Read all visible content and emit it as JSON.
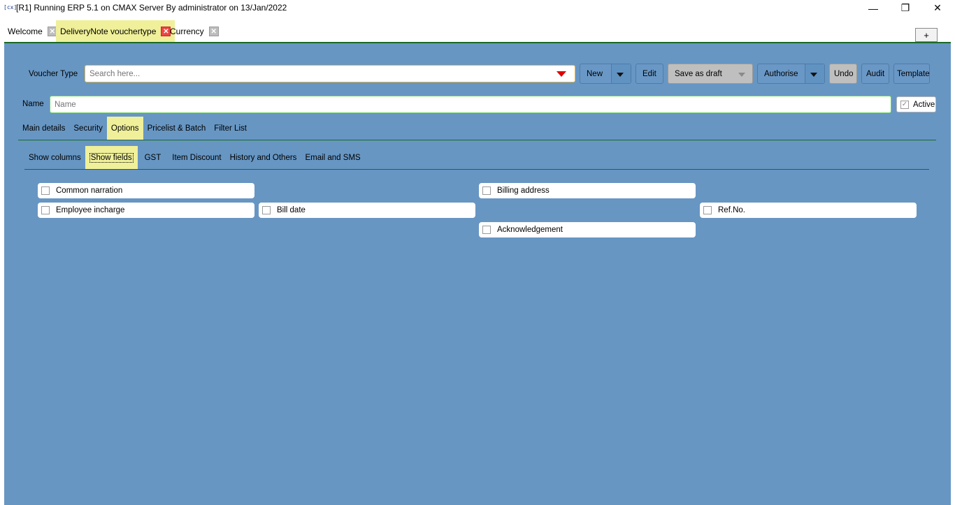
{
  "window": {
    "app_icon": "[cx]",
    "title": "[R1] Running ERP 5.1 on CMAX Server By administrator on 13/Jan/2022",
    "minimize": "—",
    "maximize": "❐",
    "close": "✕"
  },
  "doc_tabs": [
    {
      "label": "Welcome",
      "close": "✕"
    },
    {
      "label": "DeliveryNote vouchertype",
      "close": "✕"
    },
    {
      "label": "Currency",
      "close": "✕"
    }
  ],
  "new_tab_button": "+",
  "voucher_type": {
    "label": "Voucher Type",
    "search_placeholder": "Search here..."
  },
  "toolbar": {
    "new": "New",
    "edit": "Edit",
    "save_as_draft": "Save as draft",
    "authorise": "Authorise",
    "undo": "Undo",
    "audit": "Audit",
    "template": "Template"
  },
  "name_row": {
    "label": "Name",
    "placeholder": "Name",
    "active_label": "Active",
    "active_checked": true
  },
  "main_tabs": [
    "Main details",
    "Security",
    "Options",
    "Pricelist & Batch",
    "Filter List"
  ],
  "main_tabs_selected": "Options",
  "sub_tabs": [
    "Show columns",
    "Show fields",
    "GST",
    "Item Discount",
    "History and Others",
    "Email and SMS"
  ],
  "sub_tabs_selected": "Show fields",
  "fields": [
    {
      "label": "Common narration",
      "checked": false
    },
    {
      "label": "Billing address",
      "checked": false
    },
    {
      "label": "Employee incharge",
      "checked": false
    },
    {
      "label": "Bill date",
      "checked": false
    },
    {
      "label": "Ref.No.",
      "checked": false
    },
    {
      "label": "Acknowledgement",
      "checked": false
    }
  ]
}
